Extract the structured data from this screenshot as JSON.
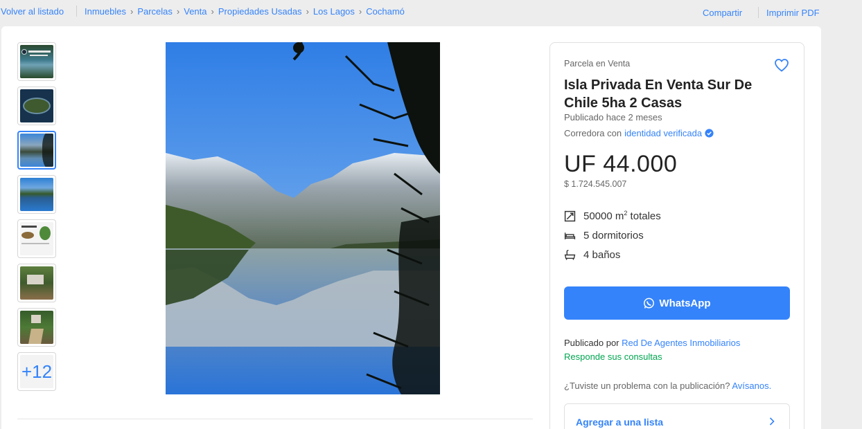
{
  "topbar": {
    "back_label": "Volver al listado",
    "breadcrumbs": [
      "Inmuebles",
      "Parcelas",
      "Venta",
      "Propiedades Usadas",
      "Los Lagos",
      "Cochamó"
    ],
    "share_label": "Compartir",
    "print_label": "Imprimir PDF"
  },
  "gallery": {
    "more_count": "+12",
    "selected_index": 2
  },
  "listing": {
    "condition": "Parcela en Venta",
    "title": "Isla Privada En Venta Sur De Chile 5ha 2 Casas",
    "published": "Publicado hace 2 meses",
    "agency_prefix": "Corredora con",
    "agency_link": "identidad verificada",
    "price": "UF 44.000",
    "price_clp": "$ 1.724.545.007",
    "attributes": {
      "area_value": "50000 m",
      "area_sup": "2",
      "area_suffix": " totales",
      "bedrooms": "5 dormitorios",
      "bathrooms": "4 baños"
    },
    "whatsapp_label": "WhatsApp",
    "published_by_prefix": "Publicado por",
    "published_by_name": "Red De Agentes Inmobiliarios",
    "responds": "Responde sus consultas",
    "problem_text": "¿Tuviste un problema con la publicación?",
    "problem_link": "Avísanos.",
    "add_list_label": "Agregar a una lista"
  },
  "colors": {
    "accent": "#3483fa",
    "success": "#00a650",
    "background": "#ededed"
  },
  "icons": [
    "heart-icon",
    "verified-icon",
    "area-icon",
    "bed-icon",
    "bath-icon",
    "whatsapp-icon",
    "chevron-right-icon"
  ]
}
